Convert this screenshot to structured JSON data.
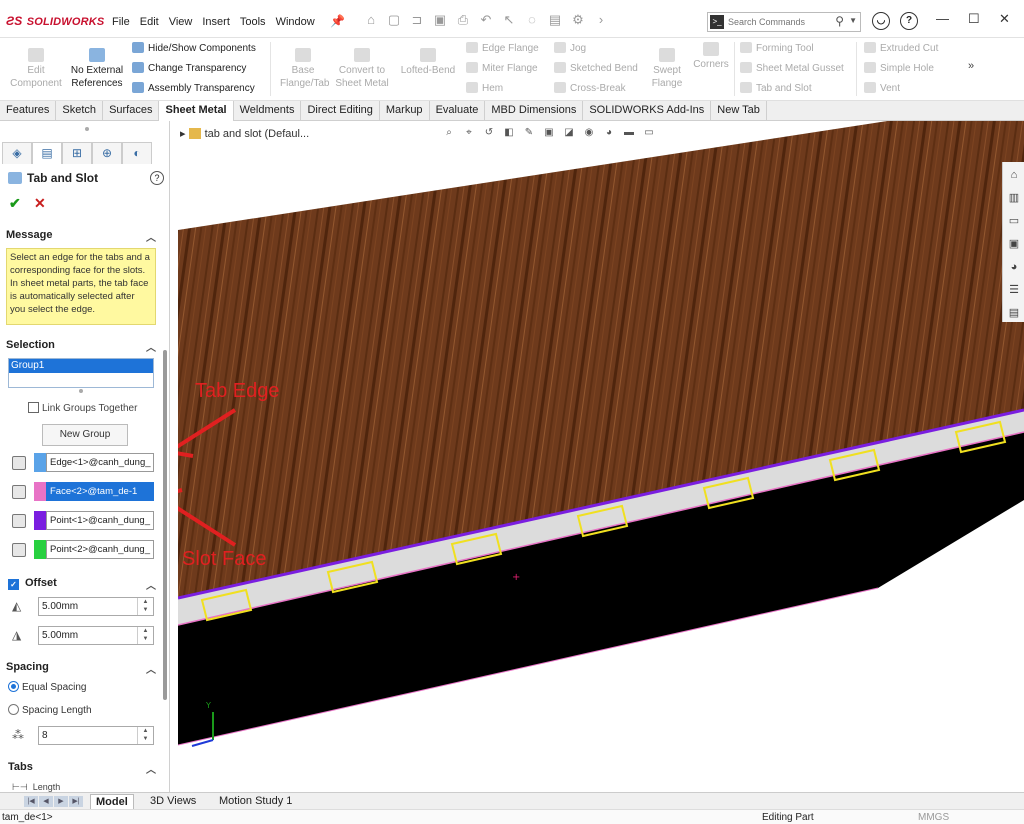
{
  "app": {
    "logo": "SOLIDWORKS"
  },
  "menu": [
    "File",
    "Edit",
    "View",
    "Insert",
    "Tools",
    "Window"
  ],
  "search": {
    "placeholder": "Search Commands"
  },
  "commandmanager": {
    "big": [
      {
        "label": "Edit Component",
        "enabled": false
      },
      {
        "label": "No External References",
        "enabled": true
      },
      {
        "label": "Base Flange/Tab",
        "enabled": false
      },
      {
        "label": "Convert to Sheet Metal",
        "enabled": false
      },
      {
        "label": "Lofted-Bend",
        "enabled": false
      },
      {
        "label": "Swept Flange",
        "enabled": false
      },
      {
        "label": "Corners",
        "enabled": false
      }
    ],
    "small": [
      {
        "label": "Hide/Show Components",
        "enabled": true
      },
      {
        "label": "Change Transparency",
        "enabled": true
      },
      {
        "label": "Assembly Transparency",
        "enabled": true
      },
      {
        "label": "Edge Flange",
        "enabled": false
      },
      {
        "label": "Miter Flange",
        "enabled": false
      },
      {
        "label": "Hem",
        "enabled": false
      },
      {
        "label": "Jog",
        "enabled": false
      },
      {
        "label": "Sketched Bend",
        "enabled": false
      },
      {
        "label": "Cross-Break",
        "enabled": false
      },
      {
        "label": "Forming Tool",
        "enabled": false
      },
      {
        "label": "Sheet Metal Gusset",
        "enabled": false
      },
      {
        "label": "Tab and Slot",
        "enabled": false
      },
      {
        "label": "Extruded Cut",
        "enabled": false
      },
      {
        "label": "Simple Hole",
        "enabled": false
      },
      {
        "label": "Vent",
        "enabled": false
      }
    ]
  },
  "tabs": [
    "Features",
    "Sketch",
    "Surfaces",
    "Sheet Metal",
    "Weldments",
    "Direct Editing",
    "Markup",
    "Evaluate",
    "MBD Dimensions",
    "SOLIDWORKS Add-Ins",
    "New Tab"
  ],
  "active_tab": "Sheet Metal",
  "property_manager": {
    "title": "Tab and Slot",
    "message_header": "Message",
    "message": "Select an edge for the tabs and a corresponding face for the slots. In sheet metal parts, the tab face is automatically selected after you select the edge.",
    "selection_header": "Selection",
    "group_item": "Group1",
    "link_groups": "Link Groups Together",
    "new_group": "New Group",
    "selections": [
      {
        "value": "Edge<1>@canh_dung_",
        "color": "#5aa3e8"
      },
      {
        "value": "Face<2>@tam_de-1",
        "color": "#e873c6"
      },
      {
        "value": "Point<1>@canh_dung_",
        "color": "#7a1ee0"
      },
      {
        "value": "Point<2>@canh_dung_",
        "color": "#28d040"
      }
    ],
    "offset_header": "Offset",
    "offset1": "5.00mm",
    "offset2": "5.00mm",
    "spacing_header": "Spacing",
    "equal_spacing": "Equal Spacing",
    "spacing_length": "Spacing Length",
    "instances": "8",
    "tabs_header": "Tabs",
    "length_label": "Length"
  },
  "viewport": {
    "tree_label": "tab and slot  (Defaul...",
    "annotation_tab": "Tab Edge",
    "annotation_slot": "Slot Face"
  },
  "bottom_tabs": [
    "Model",
    "3D Views",
    "Motion Study 1"
  ],
  "status": {
    "left": "tam_de<1>",
    "mode": "Editing Part",
    "units": "MMGS"
  }
}
